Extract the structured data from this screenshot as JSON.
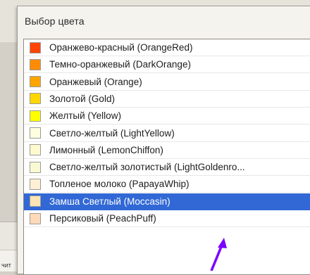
{
  "dialog": {
    "title": "Выбор цвета"
  },
  "colors": [
    {
      "label": "Оранжево-красный (OrangeRed)",
      "color": "#ff4500"
    },
    {
      "label": "Темно-оранжевый (DarkOrange)",
      "color": "#ff8c00"
    },
    {
      "label": "Оранжевый (Orange)",
      "color": "#ffa500"
    },
    {
      "label": "Золотой (Gold)",
      "color": "#ffd700"
    },
    {
      "label": "Желтый (Yellow)",
      "color": "#ffff00"
    },
    {
      "label": "Светло-желтый (LightYellow)",
      "color": "#ffffe0"
    },
    {
      "label": "Лимонный (LemonChiffon)",
      "color": "#fffacd"
    },
    {
      "label": "Светло-желтый золотистый (LightGoldenro...",
      "color": "#fafad2"
    },
    {
      "label": "Топленое молоко (PapayaWhip)",
      "color": "#ffefd5"
    },
    {
      "label": "Замша Светлый (Moccasin)",
      "color": "#ffe4b5",
      "selected": true
    },
    {
      "label": "Персиковый (PeachPuff)",
      "color": "#ffdab9"
    }
  ],
  "background": {
    "fragment_text": "чит"
  },
  "accent": {
    "selection": "#3168d5",
    "arrow": "#7a00ff"
  }
}
